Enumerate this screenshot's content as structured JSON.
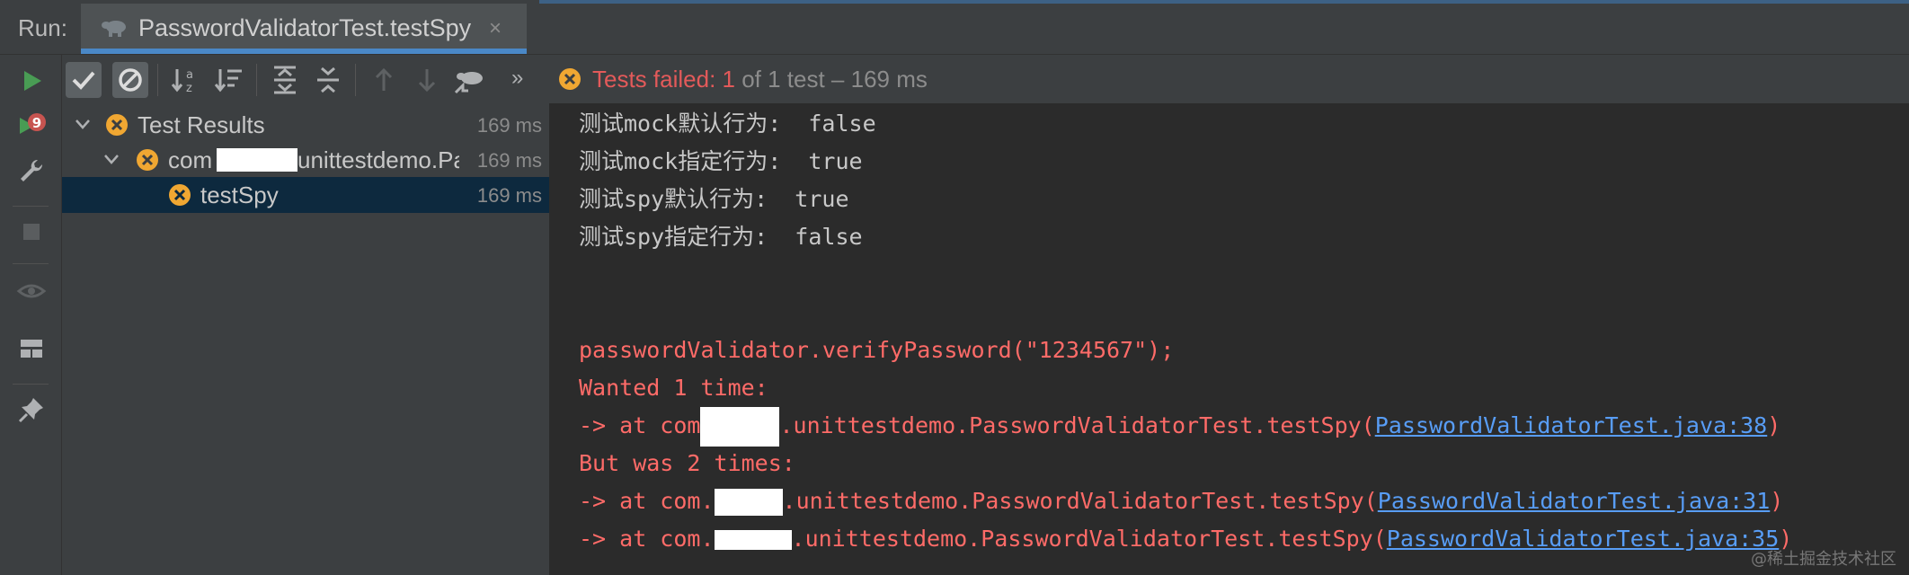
{
  "header": {
    "run_label": "Run:",
    "tab_title": "PasswordValidatorTest.testSpy",
    "tab_close": "×"
  },
  "toolbar": {
    "status_failed": "Tests failed: 1",
    "status_rest": " of 1 test – 169 ms",
    "more": "»"
  },
  "tree": {
    "rows": [
      {
        "label": "Test Results",
        "time": "169 ms"
      },
      {
        "label": "com",
        "label_suffix": "unittestdemo.Pa",
        "time": "169 ms"
      },
      {
        "label": "testSpy",
        "time": "169 ms"
      }
    ]
  },
  "console": {
    "lines": [
      "测试mock默认行为:  false",
      "测试mock指定行为:  true",
      "测试spy默认行为:  true",
      "测试spy指定行为:  false",
      "passwordValidator.verifyPassword(\"1234567\");",
      "Wanted 1 time:",
      "But was 2 times:"
    ],
    "at_lines": [
      {
        "prefix": "-> at com",
        "suffix": ".unittestdemo.PasswordValidatorTest.testSpy(",
        "link": "PasswordValidatorTest.java:38",
        "close": ")"
      },
      {
        "prefix": "-> at com.",
        "suffix": ".unittestdemo.PasswordValidatorTest.testSpy(",
        "link": "PasswordValidatorTest.java:31",
        "close": ")"
      },
      {
        "prefix": "-> at com.",
        "suffix": ".unittestdemo.PasswordValidatorTest.testSpy(",
        "link": "PasswordValidatorTest.java:35",
        "close": ")"
      }
    ]
  },
  "watermark": "@稀土掘金技术社区",
  "colors": {
    "error_text": "#ff6b68",
    "link": "#589df6",
    "status_failed": "#e35a5a",
    "warning_icon": "#f0a732",
    "selected_row": "#0d293e"
  }
}
